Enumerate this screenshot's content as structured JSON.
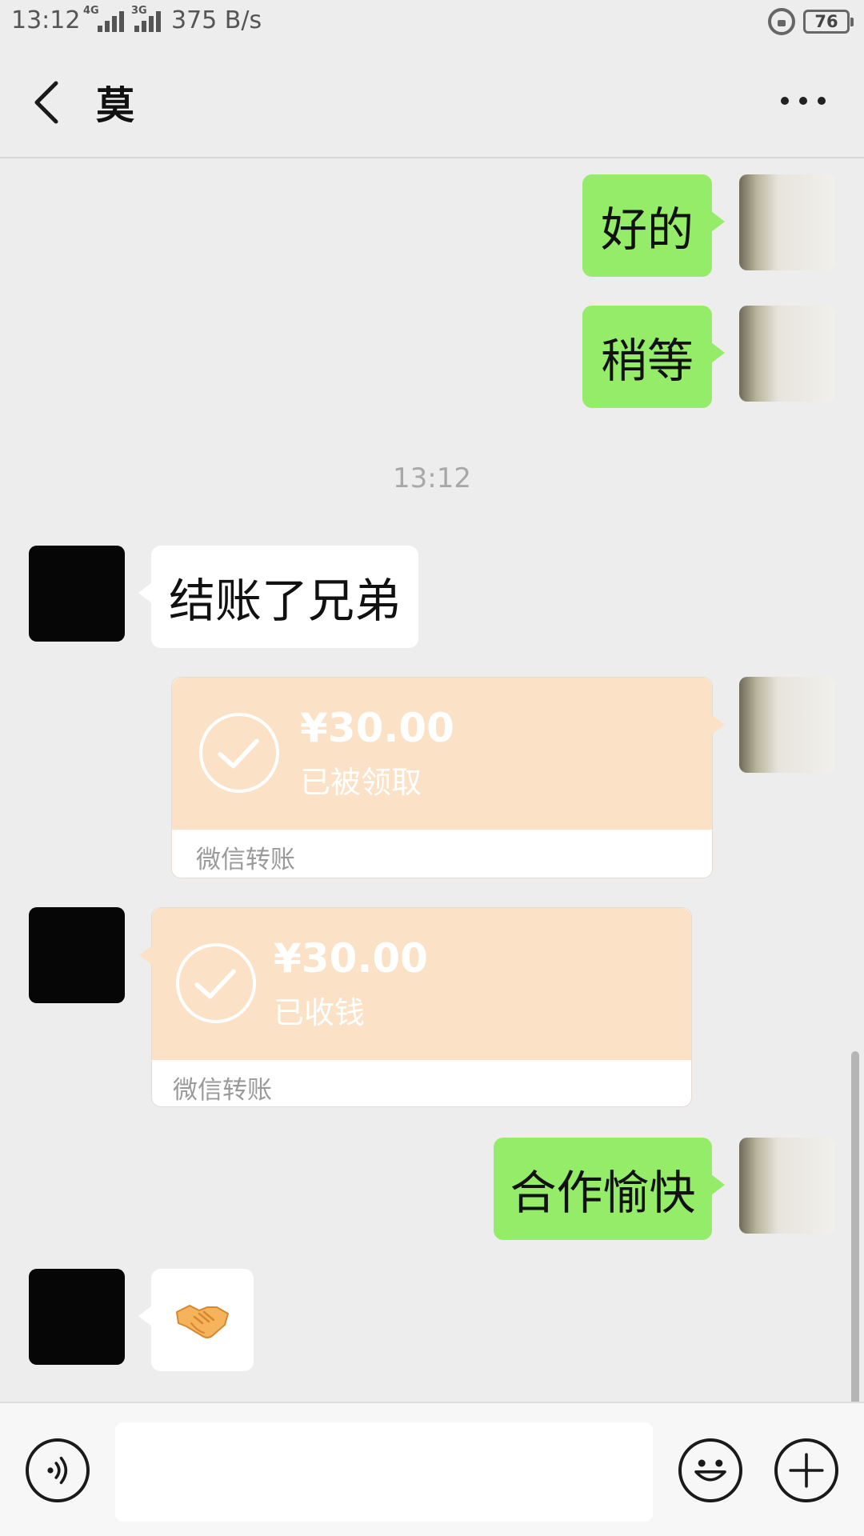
{
  "status_bar": {
    "time": "13:12",
    "network_1": "4G",
    "network_2": "3G",
    "speed": "375 B/s",
    "battery": "76"
  },
  "header": {
    "title": "莫"
  },
  "messages": [
    {
      "side": "me",
      "type": "text",
      "text": "好的"
    },
    {
      "side": "me",
      "type": "text",
      "text": "稍等"
    },
    {
      "type": "time",
      "text": "13:12"
    },
    {
      "side": "other",
      "type": "text",
      "text": "结账了兄弟"
    },
    {
      "side": "me",
      "type": "transfer",
      "amount": "¥30.00",
      "status": "已被领取",
      "footer": "微信转账"
    },
    {
      "side": "other",
      "type": "transfer",
      "amount": "¥30.00",
      "status": "已收钱",
      "footer": "微信转账"
    },
    {
      "side": "me",
      "type": "text",
      "text": "合作愉快"
    },
    {
      "side": "other",
      "type": "emoji",
      "icon": "handshake-icon"
    }
  ],
  "input_bar": {
    "placeholder": ""
  },
  "colors": {
    "background": "#ededed",
    "my_bubble": "#95ec69",
    "other_bubble": "#ffffff",
    "transfer_card": "#fbe2c6"
  }
}
